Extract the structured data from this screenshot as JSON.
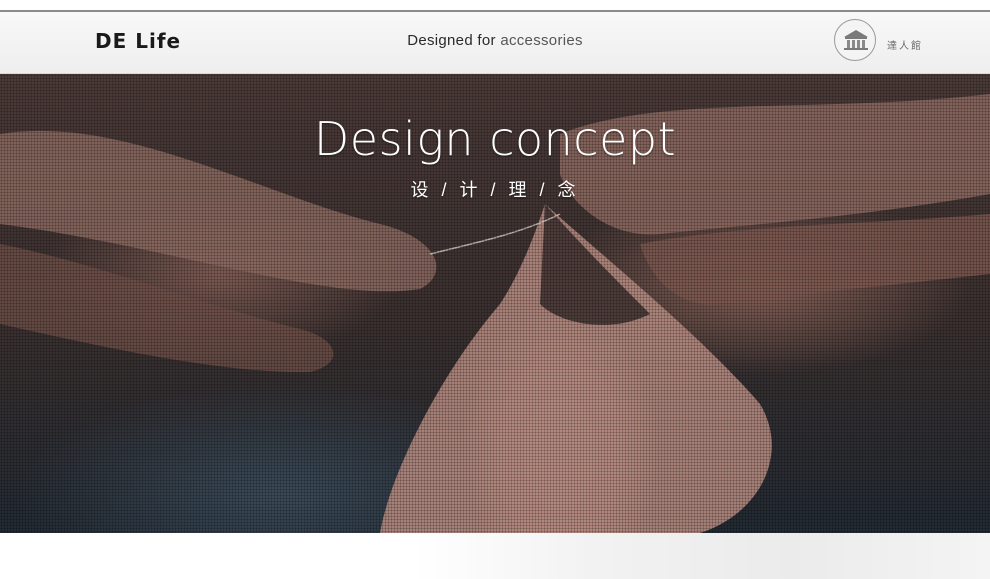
{
  "header": {
    "logo": "DE Life",
    "tagline_main": "Designed for",
    "tagline_accent": "accessories",
    "badge_text": "達人館"
  },
  "hero": {
    "title": "Design concept",
    "subtitle": "设 / 计 / 理 / 念"
  },
  "icons": {
    "badge": "building-seal-icon"
  },
  "colors": {
    "header_bg": "#f4f4f4",
    "hero_title": "#ffffff"
  }
}
